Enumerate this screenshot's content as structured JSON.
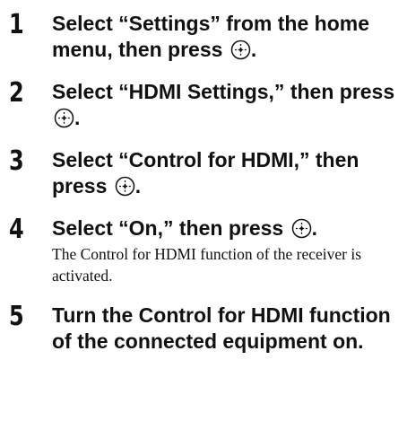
{
  "steps": [
    {
      "number": "1",
      "title_pre": "Select “Settings” from the home menu, then press",
      "title_post": ".",
      "note": ""
    },
    {
      "number": "2",
      "title_pre": "Select “HDMI Settings,” then press",
      "title_post": ".",
      "note": ""
    },
    {
      "number": "3",
      "title_pre": "Select “Control for HDMI,” then press",
      "title_post": ".",
      "note": ""
    },
    {
      "number": "4",
      "title_pre": "Select “On,” then press",
      "title_post": ".",
      "note": "The Control for HDMI function of the receiver is activated."
    },
    {
      "number": "5",
      "title_pre": "Turn the Control for HDMI function of the connected equipment on.",
      "title_post": "",
      "note": ""
    }
  ],
  "icons": {
    "enter": "enter-button-icon"
  },
  "colors": {
    "text": "#111111",
    "background": "#ffffff"
  }
}
